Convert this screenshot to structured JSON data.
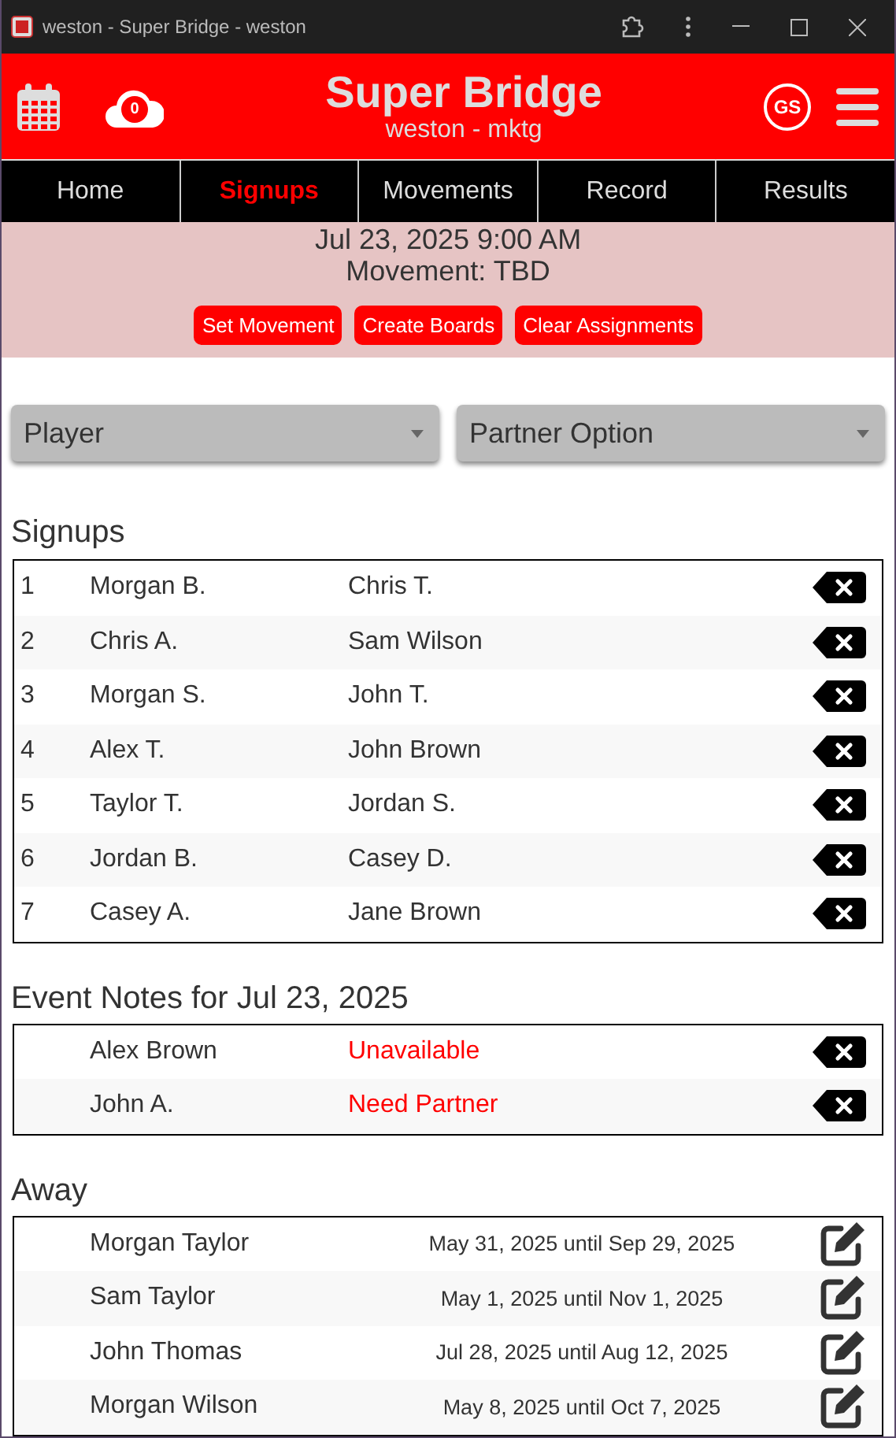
{
  "window": {
    "title": "weston - Super Bridge - weston"
  },
  "header": {
    "title": "Super Bridge",
    "subtitle": "weston - mktg",
    "cloud_count": "0",
    "avatar": "GS"
  },
  "tabs": [
    {
      "label": "Home",
      "selected": false
    },
    {
      "label": "Signups",
      "selected": true
    },
    {
      "label": "Movements",
      "selected": false
    },
    {
      "label": "Record",
      "selected": false
    },
    {
      "label": "Results",
      "selected": false
    }
  ],
  "event": {
    "datetime": "Jul 23, 2025 9:00 AM",
    "movement": "Movement: TBD",
    "buttons": [
      "Set Movement",
      "Create Boards",
      "Clear Assignments"
    ]
  },
  "selects": [
    {
      "placeholder": "Player"
    },
    {
      "placeholder": "Partner Option"
    }
  ],
  "signups": {
    "heading": "Signups",
    "rows": [
      {
        "number": "1",
        "player": "Morgan B.",
        "partner": "Chris T."
      },
      {
        "number": "2",
        "player": "Chris A.",
        "partner": "Sam Wilson"
      },
      {
        "number": "3",
        "player": "Morgan S.",
        "partner": "John T."
      },
      {
        "number": "4",
        "player": "Alex T.",
        "partner": "John Brown"
      },
      {
        "number": "5",
        "player": "Taylor T.",
        "partner": "Jordan S."
      },
      {
        "number": "6",
        "player": "Jordan B.",
        "partner": "Casey D."
      },
      {
        "number": "7",
        "player": "Casey A.",
        "partner": "Jane Brown"
      }
    ]
  },
  "notes": {
    "heading": "Event Notes for Jul 23, 2025",
    "rows": [
      {
        "player": "Alex Brown",
        "note": "Unavailable"
      },
      {
        "player": "John A.",
        "note": "Need Partner"
      }
    ]
  },
  "away": {
    "heading": "Away",
    "rows": [
      {
        "player": "Morgan Taylor",
        "period": "May 31, 2025 until Sep 29, 2025"
      },
      {
        "player": "Sam Taylor",
        "period": "May 1, 2025 until Nov 1, 2025"
      },
      {
        "player": "John Thomas",
        "period": "Jul 28, 2025 until Aug 12, 2025"
      },
      {
        "player": "Morgan Wilson",
        "period": "May 8, 2025 until Oct 7, 2025"
      }
    ]
  }
}
